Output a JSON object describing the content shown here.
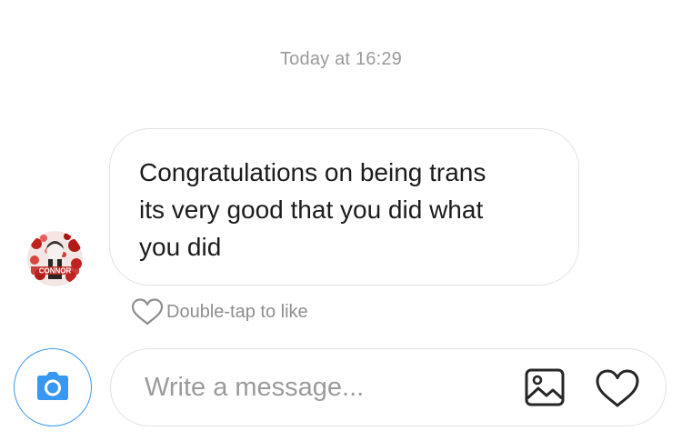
{
  "thread": {
    "timestamp": "Today at 16:29"
  },
  "message": {
    "lines": [
      "Congratulations on being trans",
      "its very good that you did what",
      "you did"
    ],
    "avatar_text": "CONNOR"
  },
  "like_hint": {
    "label": "Double-tap to like",
    "icon": "heart-outline-icon"
  },
  "composer": {
    "placeholder": "Write a message...",
    "value": "",
    "camera_icon": "camera-icon",
    "gallery_icon": "image-gallery-icon",
    "like_icon": "heart-icon"
  },
  "colors": {
    "accent": "#3897f0",
    "muted_text": "#9a9a9a",
    "bubble_border": "#e2e2e2",
    "avatar_red": "#c0231f"
  }
}
